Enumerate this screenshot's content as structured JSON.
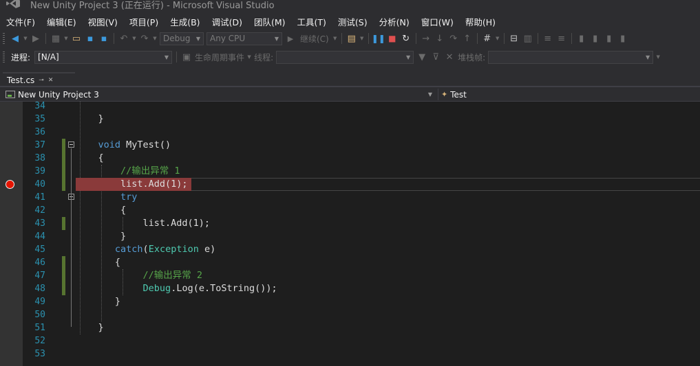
{
  "window": {
    "title": "New Unity Project 3 (正在运行) - Microsoft Visual Studio"
  },
  "menu": [
    "文件(F)",
    "编辑(E)",
    "视图(V)",
    "项目(P)",
    "生成(B)",
    "调试(D)",
    "团队(M)",
    "工具(T)",
    "测试(S)",
    "分析(N)",
    "窗口(W)",
    "帮助(H)"
  ],
  "toolbar1": {
    "config": "Debug",
    "platform": "Any CPU",
    "continue_label": "继续(C)"
  },
  "toolbar2": {
    "process_label": "进程:",
    "process_value": "[N/A]",
    "lifecycle_label": "生命周期事件",
    "thread_label": "线程:",
    "stackframe_label": "堆栈帧:"
  },
  "tab": {
    "label": "Test.cs"
  },
  "navbar": {
    "project": "New Unity Project 3",
    "member": "Test"
  },
  "editor": {
    "breakpoint_line": "40",
    "lines": [
      {
        "n": "34",
        "code": ""
      },
      {
        "n": "35",
        "code": "    }"
      },
      {
        "n": "36",
        "code": ""
      },
      {
        "n": "37",
        "code": "    void MyTest()"
      },
      {
        "n": "38",
        "code": "    {"
      },
      {
        "n": "39",
        "code": "        //输出异常 1"
      },
      {
        "n": "40",
        "code": "        list.Add(1);"
      },
      {
        "n": "41",
        "code": "        try"
      },
      {
        "n": "42",
        "code": "        {"
      },
      {
        "n": "43",
        "code": "            list.Add(1);"
      },
      {
        "n": "44",
        "code": "        }"
      },
      {
        "n": "45",
        "code": "       catch(Exception e)"
      },
      {
        "n": "46",
        "code": "       {"
      },
      {
        "n": "47",
        "code": "            //输出异常 2"
      },
      {
        "n": "48",
        "code": "            Debug.Log(e.ToString());"
      },
      {
        "n": "49",
        "code": "       }"
      },
      {
        "n": "50",
        "code": ""
      },
      {
        "n": "51",
        "code": "    }"
      },
      {
        "n": "52",
        "code": ""
      },
      {
        "n": "53",
        "code": ""
      }
    ]
  },
  "colors": {
    "keyword": "#569cd6",
    "comment": "#57a64a",
    "type": "#4ec9b0",
    "line_number": "#2b91af",
    "breakpoint": "#e51400",
    "breakpoint_highlight": "#8a3a3a",
    "change_marker": "#577430"
  }
}
